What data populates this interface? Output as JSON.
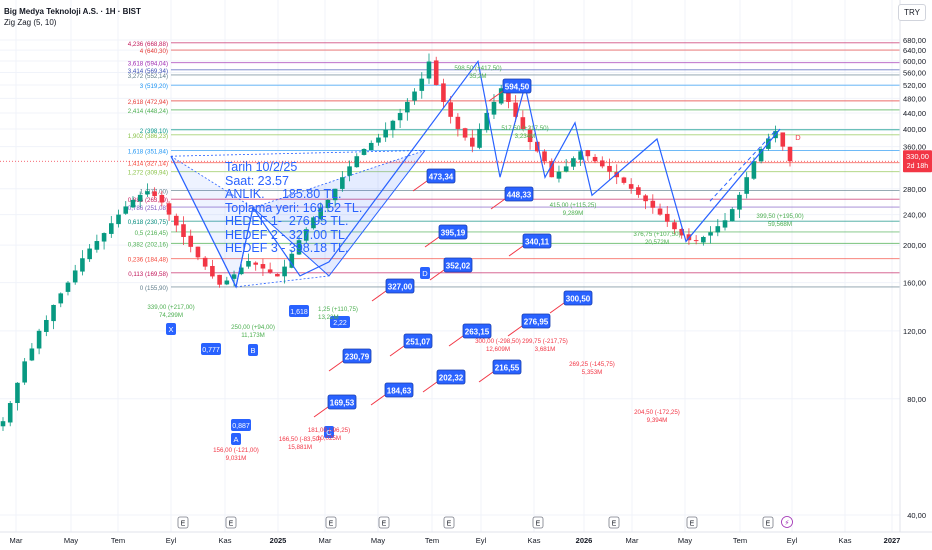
{
  "header": {
    "symbol": "Big Medya Teknoloji A.S. · 1H · BIST",
    "indicator": "Zig Zag (5, 10)"
  },
  "currency": "TRY",
  "price_tag": {
    "value": "330,00",
    "countdown": "2d 18h"
  },
  "annotation": [
    "Tarih 10/2/25",
    "Saat: 23.57",
    "ANLIK.     185.80 TL.",
    "Toplama yeri: 169.52 TL.",
    "HEDEF 1-  276.95 TL.",
    "HEDEF 2 - 327.00 TL.",
    "HEDEF 3 - 398.18 TL."
  ],
  "colors": {
    "up": "#089981",
    "down": "#f23645",
    "zigzag": "#2962ff",
    "accent": "#2962ff"
  },
  "chart_data": {
    "type": "candlestick",
    "y_scale": "log",
    "ylim": [
      37,
      800
    ],
    "y_ticks": [
      "680,00",
      "640,00",
      "600,00",
      "560,00",
      "520,00",
      "480,00",
      "440,00",
      "400,00",
      "360,00",
      "280,00",
      "240,00",
      "200,00",
      "160,00",
      "120,00",
      "80,00",
      "40,00"
    ],
    "x_ticks": [
      "Mar",
      "May",
      "Tem",
      "Eyl",
      "Kas",
      "2025",
      "Mar",
      "May",
      "Tem",
      "Eyl",
      "Kas",
      "2026",
      "Mar",
      "May",
      "Tem",
      "Eyl",
      "Kas",
      "2027"
    ],
    "fib_levels": [
      {
        "label": "4,236 (668,88)",
        "value": 668.88,
        "color": "#c2185b"
      },
      {
        "label": "4 (640,30)",
        "value": 640.3,
        "color": "#e53935"
      },
      {
        "label": "3,618 (594,04)",
        "value": 594.04,
        "color": "#9c27b0"
      },
      {
        "label": "3,414 (569,34)",
        "value": 569.34,
        "color": "#3f51b5"
      },
      {
        "label": "3,272 (552,14)",
        "value": 552.14,
        "color": "#607d8b"
      },
      {
        "label": "3 (519,20)",
        "value": 519.2,
        "color": "#2196f3"
      },
      {
        "label": "2,618 (472,94)",
        "value": 472.94,
        "color": "#e53935"
      },
      {
        "label": "2,414 (448,24)",
        "value": 448.24,
        "color": "#4caf50"
      },
      {
        "label": "2 (398,10)",
        "value": 398.1,
        "color": "#009688"
      },
      {
        "label": "1,902 (386,23)",
        "value": 386.23,
        "color": "#8bc34a"
      },
      {
        "label": "1,618 (351,84)",
        "value": 351.84,
        "color": "#2196f3"
      },
      {
        "label": "1,414 (327,14)",
        "value": 327.14,
        "color": "#f44336"
      },
      {
        "label": "1,272 (309,94)",
        "value": 309.94,
        "color": "#8bc34a"
      },
      {
        "label": "1 (277,00)",
        "value": 277.0,
        "color": "#607d8b"
      },
      {
        "label": "0,886 (263,19)",
        "value": 263.19,
        "color": "#c2185b"
      },
      {
        "label": "0,786 (251,08)",
        "value": 251.08,
        "color": "#7e57c2"
      },
      {
        "label": "0,618 (230,75)",
        "value": 230.75,
        "color": "#00897b"
      },
      {
        "label": "0,5 (216,45)",
        "value": 216.45,
        "color": "#4caf50"
      },
      {
        "label": "0,382 (202,16)",
        "value": 202.16,
        "color": "#4caf50"
      },
      {
        "label": "0,236 (184,48)",
        "value": 184.48,
        "color": "#f44336"
      },
      {
        "label": "0,113 (169,58)",
        "value": 169.58,
        "color": "#c2185b"
      },
      {
        "label": "0 (155,90)",
        "value": 155.9,
        "color": "#607d8b"
      }
    ],
    "zigzag_pivots": [
      {
        "label": "598,50 (+417,50)\n35,2M",
        "price": 598.5,
        "kind": "high"
      },
      {
        "label": "517,50 (+217,50)\n3,234M",
        "price": 517.5,
        "kind": "high"
      },
      {
        "label": "415,00 (+115,25)\n9,289M",
        "price": 415.0,
        "kind": "high"
      },
      {
        "label": "376,75 (+107,50)\n20,572M",
        "price": 376.75,
        "kind": "high"
      },
      {
        "label": "399,50 (+195,00)\n59,568M",
        "price": 399.5,
        "kind": "high"
      },
      {
        "label": "250,00 (+94,00)\n11,173M",
        "price": 250.0,
        "kind": "high"
      },
      {
        "label": "339,00 (+217,00)\n74,299M",
        "price": 339.0,
        "kind": "high"
      },
      {
        "label": "156,00 (-121,00)\n9,031M",
        "price": 156.0,
        "kind": "low"
      },
      {
        "label": "166,50 (-83,50)\n15,881M",
        "price": 166.5,
        "kind": "low"
      },
      {
        "label": "181,00 (-96,25)\n10,025M",
        "price": 181.0,
        "kind": "low"
      },
      {
        "label": "300,00 (-298,50)\n12,609M",
        "price": 300.0,
        "kind": "low"
      },
      {
        "label": "299,75 (-217,75)\n3,681M",
        "price": 299.75,
        "kind": "low"
      },
      {
        "label": "269,25 (-145,75)\n5,353M",
        "price": 269.25,
        "kind": "low"
      },
      {
        "label": "204,50 (-172,25)\n9,394M",
        "price": 204.5,
        "kind": "low"
      }
    ],
    "price_tags": [
      "594,50",
      "473,34",
      "448,33",
      "395,19",
      "352,02",
      "327,00",
      "251,07",
      "230,79",
      "263,15",
      "276,95",
      "216,55",
      "202,32",
      "184,63",
      "169,53",
      "300,50",
      "340,11"
    ],
    "pattern_points": [
      "X",
      "A",
      "B",
      "C",
      "D"
    ],
    "ratio_tags": [
      "0,777",
      "0,887",
      "1,618",
      "2,22"
    ],
    "pattern_ratio_text": "1,25 (+110,75)\n13,22M",
    "extra_labels": [
      "E",
      "E",
      "E",
      "E",
      "E",
      "E",
      "E",
      "E",
      "E",
      "E"
    ],
    "last_price": 330.0,
    "series": [
      {
        "name": "price",
        "values": [
          70,
          78,
          88,
          100,
          108,
          120,
          128,
          140,
          150,
          160,
          172,
          185,
          196,
          205,
          215,
          228,
          240,
          252,
          262,
          270,
          276,
          268,
          258,
          240,
          225,
          210,
          198,
          186,
          176,
          166,
          158,
          162,
          168,
          175,
          182,
          178,
          174,
          170,
          166,
          176,
          190,
          206,
          220,
          236,
          250,
          262,
          280,
          300,
          320,
          340,
          355,
          368,
          380,
          398,
          420,
          440,
          470,
          500,
          540,
          598,
          520,
          470,
          430,
          400,
          380,
          360,
          400,
          440,
          470,
          510,
          470,
          430,
          400,
          370,
          350,
          330,
          300,
          310,
          320,
          336,
          350,
          340,
          330,
          320,
          310,
          300,
          290,
          280,
          270,
          260,
          250,
          240,
          230,
          220,
          212,
          206,
          205,
          210,
          216,
          224,
          232,
          248,
          270,
          300,
          330,
          355,
          378,
          395,
          360,
          330
        ]
      }
    ]
  }
}
